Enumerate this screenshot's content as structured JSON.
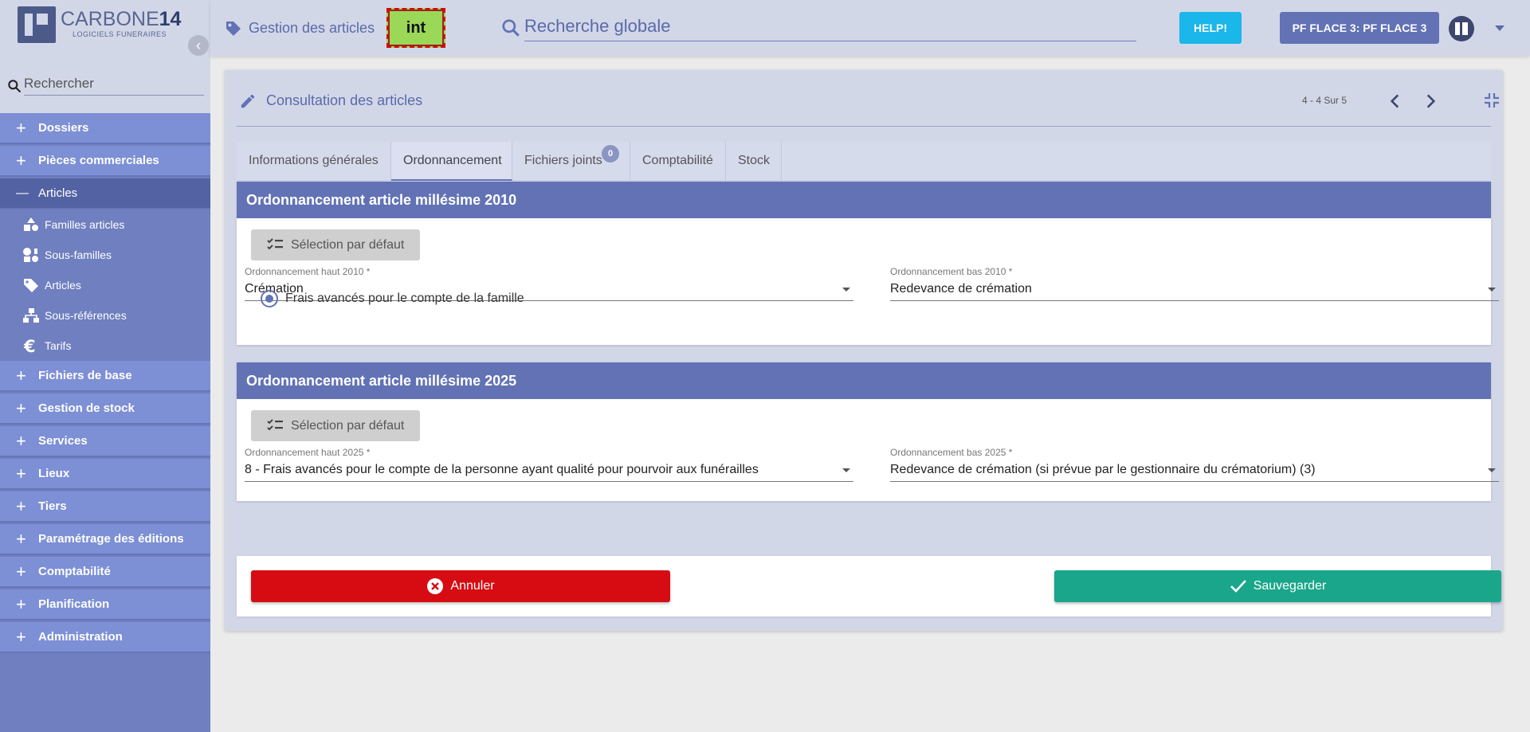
{
  "brand": {
    "name_light": "CARBONE",
    "name_bold": "14",
    "tagline": "LOGICIELS FUNERAIRES"
  },
  "sidebar": {
    "search_placeholder": "Rechercher",
    "items": [
      {
        "label": "Dossiers",
        "sign": "+"
      },
      {
        "label": "Pièces commerciales",
        "sign": "+"
      },
      {
        "label": "Articles",
        "sign": "—"
      },
      {
        "label": "Fichiers de base",
        "sign": "+"
      },
      {
        "label": "Gestion de stock",
        "sign": "+"
      },
      {
        "label": "Services",
        "sign": "+"
      },
      {
        "label": "Lieux",
        "sign": "+"
      },
      {
        "label": "Tiers",
        "sign": "+"
      },
      {
        "label": "Paramétrage des éditions",
        "sign": "+"
      },
      {
        "label": "Comptabilité",
        "sign": "+"
      },
      {
        "label": "Planification",
        "sign": "+"
      },
      {
        "label": "Administration",
        "sign": "+"
      }
    ],
    "subitems": [
      {
        "label": "Familles articles",
        "icon": "shapes-icon"
      },
      {
        "label": "Sous-familles",
        "icon": "shapes-alt-icon"
      },
      {
        "label": "Articles",
        "icon": "tag-icon"
      },
      {
        "label": "Sous-références",
        "icon": "sitemap-icon"
      },
      {
        "label": "Tarifs",
        "icon": "euro-icon"
      }
    ]
  },
  "header": {
    "title": "Gestion des articles",
    "env_badge": "int",
    "search_placeholder": "Recherche globale",
    "help_label": "HELP!",
    "site_label": "PF FLACE 3: PF FLACE 3"
  },
  "main": {
    "title": "Consultation des articles",
    "pager": "4 - 4 Sur 5",
    "tabs": [
      {
        "label": "Informations générales"
      },
      {
        "label": "Ordonnancement",
        "active": true
      },
      {
        "label": "Fichiers joints",
        "badge": "0"
      },
      {
        "label": "Comptabilité"
      },
      {
        "label": "Stock"
      }
    ],
    "sections": [
      {
        "title": "Ordonnancement article millésime 2010",
        "default_button": "Sélection par défaut",
        "field_high": {
          "label": "Ordonnancement haut 2010 *",
          "value": "Crémation"
        },
        "field_low": {
          "label": "Ordonnancement bas 2010 *",
          "value": "Redevance de crémation"
        },
        "radio_label": "Frais avancés pour le compte de la famille"
      },
      {
        "title": "Ordonnancement article millésime 2025",
        "default_button": "Sélection par défaut",
        "field_high": {
          "label": "Ordonnancement haut 2025 *",
          "value": "8 - Frais avancés pour le compte de la personne ayant qualité pour pourvoir aux funérailles"
        },
        "field_low": {
          "label": "Ordonnancement bas 2025 *",
          "value": "Redevance de crémation (si prévue par le gestionnaire du crématorium) (3)"
        }
      }
    ],
    "cancel_label": "Annuler",
    "save_label": "Sauvegarder"
  },
  "colors": {
    "primary": "#6272b5",
    "sidebar": "#7d8fd5",
    "cancel": "#d60c12",
    "save": "#1aa68a",
    "help": "#1bb6ea",
    "env": "#9bd858"
  }
}
